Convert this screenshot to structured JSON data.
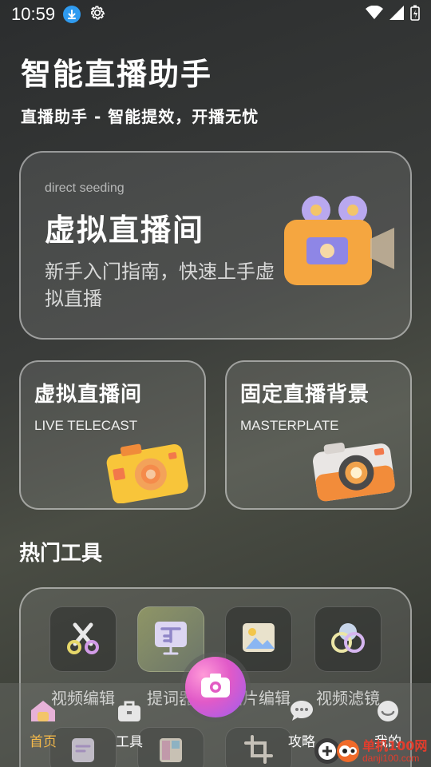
{
  "status_bar": {
    "time": "10:59"
  },
  "header": {
    "title": "智能直播助手",
    "subtitle": "直播助手 - 智能提效，开播无忧"
  },
  "hero_card": {
    "small_label": "direct seeding",
    "title": "虚拟直播间",
    "description": "新手入门指南，快速上手虚拟直播",
    "icon": "movie-camera-icon"
  },
  "feature_cards": [
    {
      "title": "虚拟直播间",
      "subtitle": "LIVE TELECAST",
      "icon": "yellow-camera-icon"
    },
    {
      "title": "固定直播背景",
      "subtitle": "MASTERPLATE",
      "icon": "orange-camera-icon"
    }
  ],
  "tools_section": {
    "title": "热门工具",
    "tools": [
      {
        "label": "视频编辑",
        "icon": "scissors-icon"
      },
      {
        "label": "提词器",
        "icon": "teleprompter-icon"
      },
      {
        "label": "图片编辑",
        "icon": "image-icon"
      },
      {
        "label": "视频滤镜",
        "icon": "filter-icon"
      }
    ]
  },
  "bottom_nav": {
    "items": [
      {
        "label": "首页",
        "icon": "home-icon",
        "active": true
      },
      {
        "label": "工具",
        "icon": "toolbox-icon",
        "active": false
      },
      {
        "label": "攻略",
        "icon": "chat-icon",
        "active": false
      },
      {
        "label": "我的",
        "icon": "profile-icon",
        "active": false
      }
    ],
    "center_button_icon": "camera-icon"
  },
  "watermark": {
    "line1": "单机100网",
    "line2": "danji100.com"
  },
  "colors": {
    "accent_active": "#f5b94a",
    "download_badge": "#2f9bf0",
    "fab_gradient_start": "#ff9ad8",
    "fab_gradient_end": "#9b5ef0"
  }
}
